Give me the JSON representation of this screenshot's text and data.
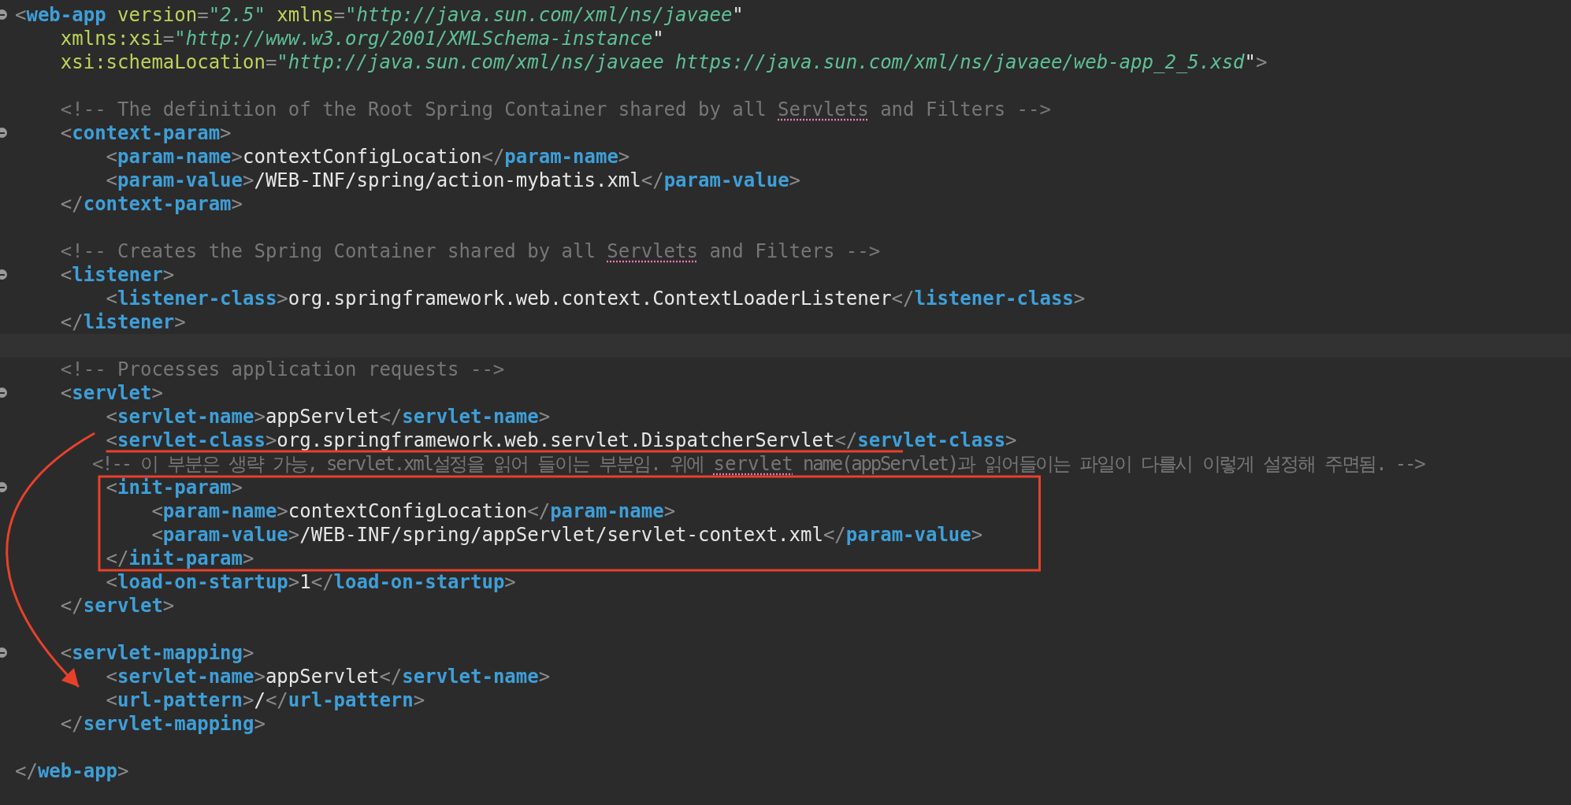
{
  "lines": [
    {
      "kind": "code",
      "fold": true,
      "tokens": [
        {
          "kind": "punct",
          "text": "<"
        },
        {
          "kind": "tag",
          "text": "web-app"
        },
        {
          "kind": "attr",
          "text": " version"
        },
        {
          "kind": "punct",
          "text": "="
        },
        {
          "kind": "value",
          "text": "\"2.5\""
        },
        {
          "kind": "attr",
          "text": " xmlns"
        },
        {
          "kind": "punct",
          "text": "="
        },
        {
          "kind": "value",
          "text": "\"http://java.sun.com/xml/ns/javaee"
        },
        {
          "kind": "text",
          "text": "\""
        }
      ]
    },
    {
      "kind": "code",
      "fold": false,
      "tokens": [
        {
          "kind": "attr",
          "text": "    xmlns:xsi"
        },
        {
          "kind": "punct",
          "text": "="
        },
        {
          "kind": "value",
          "text": "\"http://www.w3.org/2001/XMLSchema-instance"
        },
        {
          "kind": "text",
          "text": "\""
        }
      ]
    },
    {
      "kind": "code",
      "fold": false,
      "tokens": [
        {
          "kind": "attr",
          "text": "    xsi:schemaLocation"
        },
        {
          "kind": "punct",
          "text": "="
        },
        {
          "kind": "value",
          "text": "\"http://java.sun.com/xml/ns/javaee https://java.sun.com/xml/ns/javaee/web-app_2_5.xsd"
        },
        {
          "kind": "text",
          "text": "\""
        },
        {
          "kind": "punct",
          "text": ">"
        }
      ]
    },
    {
      "kind": "blank"
    },
    {
      "kind": "code",
      "fold": false,
      "tokens": [
        {
          "kind": "comment",
          "text": "    <!-- The definition of the Root Spring Container shared by all "
        },
        {
          "kind": "misspelled",
          "text": "Servlets"
        },
        {
          "kind": "comment",
          "text": " and Filters -->"
        }
      ]
    },
    {
      "kind": "code",
      "fold": true,
      "tokens": [
        {
          "kind": "punct",
          "text": "    <"
        },
        {
          "kind": "tag",
          "text": "context-param"
        },
        {
          "kind": "punct",
          "text": ">"
        }
      ]
    },
    {
      "kind": "code",
      "fold": false,
      "tokens": [
        {
          "kind": "punct",
          "text": "        <"
        },
        {
          "kind": "tag",
          "text": "param-name"
        },
        {
          "kind": "punct",
          "text": ">"
        },
        {
          "kind": "text",
          "text": "contextConfigLocation"
        },
        {
          "kind": "punct",
          "text": "</"
        },
        {
          "kind": "tag",
          "text": "param-name"
        },
        {
          "kind": "punct",
          "text": ">"
        }
      ]
    },
    {
      "kind": "code",
      "fold": false,
      "tokens": [
        {
          "kind": "punct",
          "text": "        <"
        },
        {
          "kind": "tag",
          "text": "param-value"
        },
        {
          "kind": "punct",
          "text": ">"
        },
        {
          "kind": "text",
          "text": "/WEB-INF/spring/action-mybatis.xml"
        },
        {
          "kind": "punct",
          "text": "</"
        },
        {
          "kind": "tag",
          "text": "param-value"
        },
        {
          "kind": "punct",
          "text": ">"
        }
      ]
    },
    {
      "kind": "code",
      "fold": false,
      "tokens": [
        {
          "kind": "punct",
          "text": "    </"
        },
        {
          "kind": "tag",
          "text": "context-param"
        },
        {
          "kind": "punct",
          "text": ">"
        }
      ]
    },
    {
      "kind": "blank"
    },
    {
      "kind": "code",
      "fold": false,
      "tokens": [
        {
          "kind": "comment",
          "text": "    <!-- Creates the Spring Container shared by all "
        },
        {
          "kind": "misspelled",
          "text": "Servlets"
        },
        {
          "kind": "comment",
          "text": " and Filters -->"
        }
      ]
    },
    {
      "kind": "code",
      "fold": true,
      "tokens": [
        {
          "kind": "punct",
          "text": "    <"
        },
        {
          "kind": "tag",
          "text": "listener"
        },
        {
          "kind": "punct",
          "text": ">"
        }
      ]
    },
    {
      "kind": "code",
      "fold": false,
      "tokens": [
        {
          "kind": "punct",
          "text": "        <"
        },
        {
          "kind": "tag",
          "text": "listener-class"
        },
        {
          "kind": "punct",
          "text": ">"
        },
        {
          "kind": "text",
          "text": "org.springframework.web.context.ContextLoaderListener"
        },
        {
          "kind": "punct",
          "text": "</"
        },
        {
          "kind": "tag",
          "text": "listener-class"
        },
        {
          "kind": "punct",
          "text": ">"
        }
      ]
    },
    {
      "kind": "code",
      "fold": false,
      "tokens": [
        {
          "kind": "punct",
          "text": "    </"
        },
        {
          "kind": "tag",
          "text": "listener"
        },
        {
          "kind": "punct",
          "text": ">"
        }
      ]
    },
    {
      "kind": "cursor"
    },
    {
      "kind": "code",
      "fold": false,
      "tokens": [
        {
          "kind": "comment",
          "text": "    <!-- Processes application requests -->"
        }
      ]
    },
    {
      "kind": "code",
      "fold": true,
      "tokens": [
        {
          "kind": "punct",
          "text": "    <"
        },
        {
          "kind": "tag",
          "text": "servlet"
        },
        {
          "kind": "punct",
          "text": ">"
        }
      ]
    },
    {
      "kind": "code",
      "fold": false,
      "tokens": [
        {
          "kind": "punct",
          "text": "        <"
        },
        {
          "kind": "tag",
          "text": "servlet-name"
        },
        {
          "kind": "punct",
          "text": ">"
        },
        {
          "kind": "text",
          "text": "appServlet"
        },
        {
          "kind": "punct",
          "text": "</"
        },
        {
          "kind": "tag",
          "text": "servlet-name"
        },
        {
          "kind": "punct",
          "text": ">"
        }
      ]
    },
    {
      "kind": "code",
      "fold": false,
      "tokens": [
        {
          "kind": "punct",
          "text": "        <"
        },
        {
          "kind": "tag",
          "text": "servlet-class"
        },
        {
          "kind": "punct",
          "text": ">"
        },
        {
          "kind": "text",
          "text": "org.springframework.web.servlet.DispatcherServlet"
        },
        {
          "kind": "punct",
          "text": "</"
        },
        {
          "kind": "tag",
          "text": "servlet-class"
        },
        {
          "kind": "punct",
          "text": ">"
        }
      ]
    },
    {
      "kind": "code",
      "fold": false,
      "tokens": [
        {
          "kind": "comment",
          "text": "        <!-- 이 부분은 생략 가능, servlet.xml설정을 읽어 들이는 부분임. 위에 "
        },
        {
          "kind": "misspelled",
          "text": "servlet"
        },
        {
          "kind": "comment",
          "text": " name(appServlet)과 읽어들이는 파일이 다를시 이렇게 설정해 주면됨. -->"
        }
      ]
    },
    {
      "kind": "code",
      "fold": true,
      "tokens": [
        {
          "kind": "punct",
          "text": "        <"
        },
        {
          "kind": "tag",
          "text": "init-param"
        },
        {
          "kind": "punct",
          "text": ">"
        }
      ]
    },
    {
      "kind": "code",
      "fold": false,
      "tokens": [
        {
          "kind": "punct",
          "text": "            <"
        },
        {
          "kind": "tag",
          "text": "param-name"
        },
        {
          "kind": "punct",
          "text": ">"
        },
        {
          "kind": "text",
          "text": "contextConfigLocation"
        },
        {
          "kind": "punct",
          "text": "</"
        },
        {
          "kind": "tag",
          "text": "param-name"
        },
        {
          "kind": "punct",
          "text": ">"
        }
      ]
    },
    {
      "kind": "code",
      "fold": false,
      "tokens": [
        {
          "kind": "punct",
          "text": "            <"
        },
        {
          "kind": "tag",
          "text": "param-value"
        },
        {
          "kind": "punct",
          "text": ">"
        },
        {
          "kind": "text",
          "text": "/WEB-INF/spring/appServlet/servlet-context.xml"
        },
        {
          "kind": "punct",
          "text": "</"
        },
        {
          "kind": "tag",
          "text": "param-value"
        },
        {
          "kind": "punct",
          "text": ">"
        }
      ]
    },
    {
      "kind": "code",
      "fold": false,
      "tokens": [
        {
          "kind": "punct",
          "text": "        </"
        },
        {
          "kind": "tag",
          "text": "init-param"
        },
        {
          "kind": "punct",
          "text": ">"
        }
      ]
    },
    {
      "kind": "code",
      "fold": false,
      "tokens": [
        {
          "kind": "punct",
          "text": "        <"
        },
        {
          "kind": "tag",
          "text": "load-on-startup"
        },
        {
          "kind": "punct",
          "text": ">"
        },
        {
          "kind": "text",
          "text": "1"
        },
        {
          "kind": "punct",
          "text": "</"
        },
        {
          "kind": "tag",
          "text": "load-on-startup"
        },
        {
          "kind": "punct",
          "text": ">"
        }
      ]
    },
    {
      "kind": "code",
      "fold": false,
      "tokens": [
        {
          "kind": "punct",
          "text": "    </"
        },
        {
          "kind": "tag",
          "text": "servlet"
        },
        {
          "kind": "punct",
          "text": ">"
        }
      ]
    },
    {
      "kind": "blank"
    },
    {
      "kind": "code",
      "fold": true,
      "tokens": [
        {
          "kind": "punct",
          "text": "    <"
        },
        {
          "kind": "tag",
          "text": "servlet-mapping"
        },
        {
          "kind": "punct",
          "text": ">"
        }
      ]
    },
    {
      "kind": "code",
      "fold": false,
      "tokens": [
        {
          "kind": "punct",
          "text": "        <"
        },
        {
          "kind": "tag",
          "text": "servlet-name"
        },
        {
          "kind": "punct",
          "text": ">"
        },
        {
          "kind": "text",
          "text": "appServlet"
        },
        {
          "kind": "punct",
          "text": "</"
        },
        {
          "kind": "tag",
          "text": "servlet-name"
        },
        {
          "kind": "punct",
          "text": ">"
        }
      ]
    },
    {
      "kind": "code",
      "fold": false,
      "tokens": [
        {
          "kind": "punct",
          "text": "        <"
        },
        {
          "kind": "tag",
          "text": "url-pattern"
        },
        {
          "kind": "punct",
          "text": ">"
        },
        {
          "kind": "text",
          "text": "/"
        },
        {
          "kind": "punct",
          "text": "</"
        },
        {
          "kind": "tag",
          "text": "url-pattern"
        },
        {
          "kind": "punct",
          "text": ">"
        }
      ]
    },
    {
      "kind": "code",
      "fold": false,
      "tokens": [
        {
          "kind": "punct",
          "text": "    </"
        },
        {
          "kind": "tag",
          "text": "servlet-mapping"
        },
        {
          "kind": "punct",
          "text": ">"
        }
      ]
    },
    {
      "kind": "blank"
    },
    {
      "kind": "code",
      "fold": false,
      "tokens": [
        {
          "kind": "punct",
          "text": "</"
        },
        {
          "kind": "tag",
          "text": "web-app"
        },
        {
          "kind": "punct",
          "text": ">"
        }
      ]
    }
  ],
  "annotations": [
    {
      "kind": "underline"
    },
    {
      "kind": "box"
    },
    {
      "kind": "arrow"
    }
  ]
}
